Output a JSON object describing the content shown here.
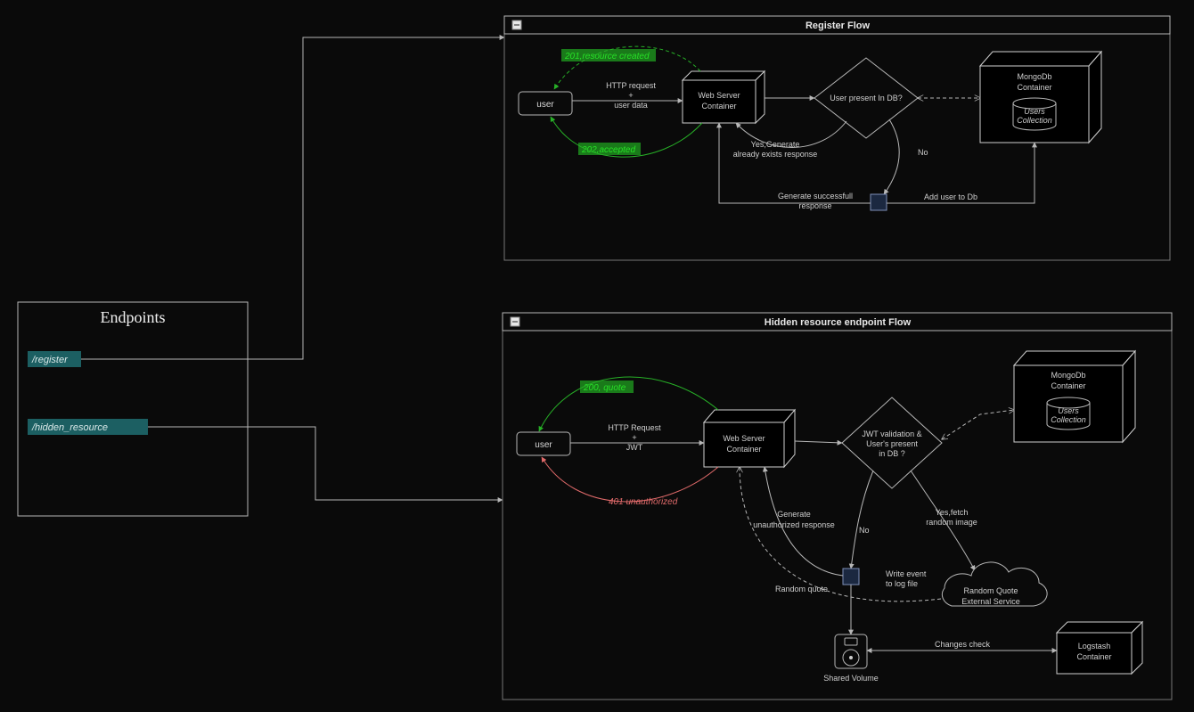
{
  "endpoints": {
    "title": "Endpoints",
    "register": "/register",
    "hidden": "/hidden_resource"
  },
  "registerFlow": {
    "title": "Register Flow",
    "user": "user",
    "httpLabel1": "HTTP request",
    "httpLabel2": "+",
    "httpLabel3": "user data",
    "webServer1": "Web Server",
    "webServer2": "Container",
    "decision": "User present In DB?",
    "mongo1": "MongoDb",
    "mongo2": "Container",
    "users1": "Users",
    "users2": "Collection",
    "tag201": "201,resource created",
    "tag202": "202,accepted",
    "yes1": "Yes,Generate",
    "yes2": "already exists response",
    "no": "No",
    "success1": "Generate successfull",
    "success2": "response",
    "addUser": "Add user to Db"
  },
  "hiddenFlow": {
    "title": "Hidden resource endpoint Flow",
    "user": "user",
    "httpLabel1": "HTTP Request",
    "httpLabel2": "+",
    "httpLabel3": "JWT",
    "webServer1": "Web Server",
    "webServer2": "Container",
    "decision1": "JWT validation &",
    "decision2": "User's present",
    "decision3": "in DB ?",
    "mongo1": "MongoDb",
    "mongo2": "Container",
    "users1": "Users",
    "users2": "Collection",
    "tag200": "200, quote",
    "tag401": "401 unauthorized",
    "gen1": "Generate",
    "gen2": "unauthorized response",
    "no": "No",
    "yes1": "Yes,fetch",
    "yes2": "random image",
    "quote": "Random quote",
    "write1": "Write event",
    "write2": "to log file",
    "cloud1": "Random Quote",
    "cloud2": "External Service",
    "shared": "Shared Volume",
    "changes": "Changes check",
    "logstash1": "Logstash",
    "logstash2": "Container"
  }
}
